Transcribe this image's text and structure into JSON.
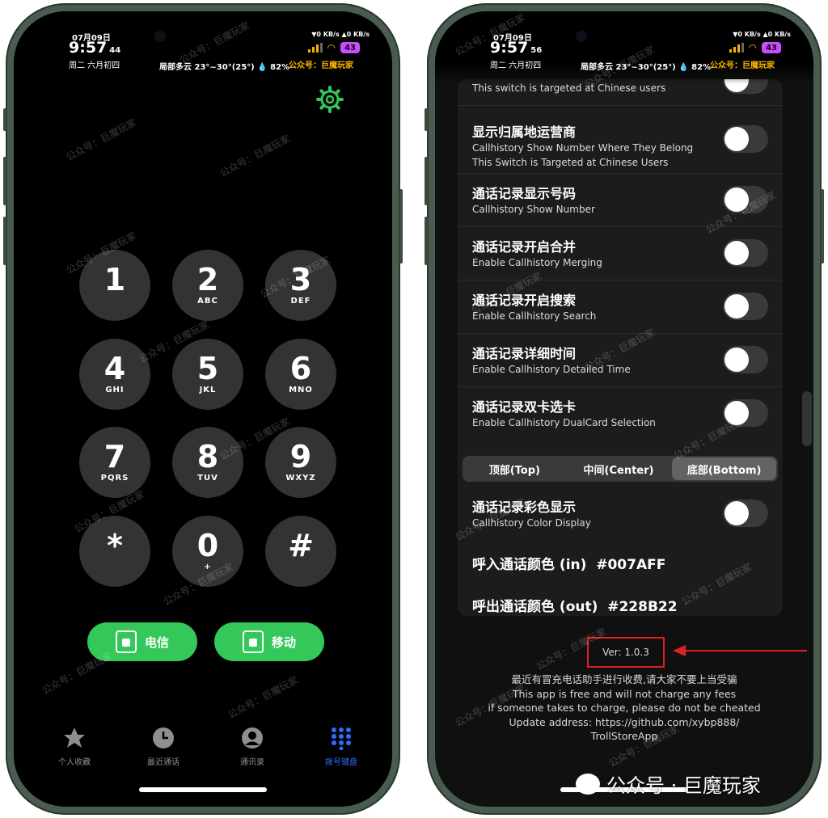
{
  "status_left": {
    "date": "07月09日",
    "time": "9:57",
    "seconds": "44",
    "lunar": "周二 六月初四",
    "weather": "局部多云 23°~30°(25°) 💧 82%",
    "net": "▼0 KB/s ▲0 KB/s",
    "battery": "43",
    "account": "公众号：巨魔玩家"
  },
  "status_right": {
    "date": "07月09日",
    "time": "9:57",
    "seconds": "56",
    "lunar": "周二 六月初四",
    "weather": "局部多云 23°~30°(25°) 💧 82%",
    "net": "▼0 KB/s ▲0 KB/s",
    "battery": "43",
    "account": "公众号：巨魔玩家"
  },
  "keypad": [
    {
      "digit": "1",
      "letters": ""
    },
    {
      "digit": "2",
      "letters": "ABC"
    },
    {
      "digit": "3",
      "letters": "DEF"
    },
    {
      "digit": "4",
      "letters": "GHI"
    },
    {
      "digit": "5",
      "letters": "JKL"
    },
    {
      "digit": "6",
      "letters": "MNO"
    },
    {
      "digit": "7",
      "letters": "PQRS"
    },
    {
      "digit": "8",
      "letters": "TUV"
    },
    {
      "digit": "9",
      "letters": "WXYZ"
    },
    {
      "digit": "*",
      "letters": ""
    },
    {
      "digit": "0",
      "letters": "+"
    },
    {
      "digit": "#",
      "letters": ""
    }
  ],
  "sim_buttons": [
    "电信",
    "移动"
  ],
  "tabs": [
    {
      "label": "个人收藏",
      "icon": "star-icon"
    },
    {
      "label": "最近通话",
      "icon": "clock-icon"
    },
    {
      "label": "通讯录",
      "icon": "person-icon"
    },
    {
      "label": "拨号键盘",
      "icon": "keypad-icon"
    }
  ],
  "settings": {
    "partial_top": "This switch is targeted at Chinese users",
    "rows": [
      {
        "title": "显示归属地运营商",
        "sub1": "Callhistory Show Number Where They Belong",
        "sub2": "This Switch is Targeted at Chinese Users"
      },
      {
        "title": "通话记录显示号码",
        "sub1": "Callhistory Show Number"
      },
      {
        "title": "通话记录开启合并",
        "sub1": "Enable Callhistory Merging"
      },
      {
        "title": "通话记录开启搜索",
        "sub1": "Enable Callhistory Search"
      },
      {
        "title": "通话记录详细时间",
        "sub1": "Enable Callhistory Detailed Time"
      },
      {
        "title": "通话记录双卡选卡",
        "sub1": "Enable Callhistory DualCard Selection"
      }
    ],
    "segments": [
      "顶部(Top)",
      "中间(Center)",
      "底部(Bottom)"
    ],
    "selected_segment": "底部(Bottom)",
    "color_row": {
      "title": "通话记录彩色显示",
      "sub1": "Callhistory Color Display"
    },
    "incoming_label": "呼入通话颜色 (in)",
    "incoming_value": "#007AFF",
    "outgoing_label": "呼出通话颜色 (out)",
    "outgoing_value": "#228B22"
  },
  "footer": {
    "version": "Ver: 1.0.3",
    "line1": "最近有冒充电话助手进行收费,请大家不要上当受骗",
    "line2": "This app is free and will not charge any fees",
    "line3": "if someone takes to charge, please do not be cheated",
    "line4": "Update address: https://github.com/xybp888/",
    "line5": "TrollStoreApp"
  },
  "watermark": "公众号：巨魔玩家",
  "wechat_badge": "公众号 · 巨魔玩家",
  "colors": {
    "accent_green": "#34c759",
    "status_yellow": "#f5b400",
    "tab_active": "#2f6bff",
    "highlight_red": "#e02020"
  }
}
